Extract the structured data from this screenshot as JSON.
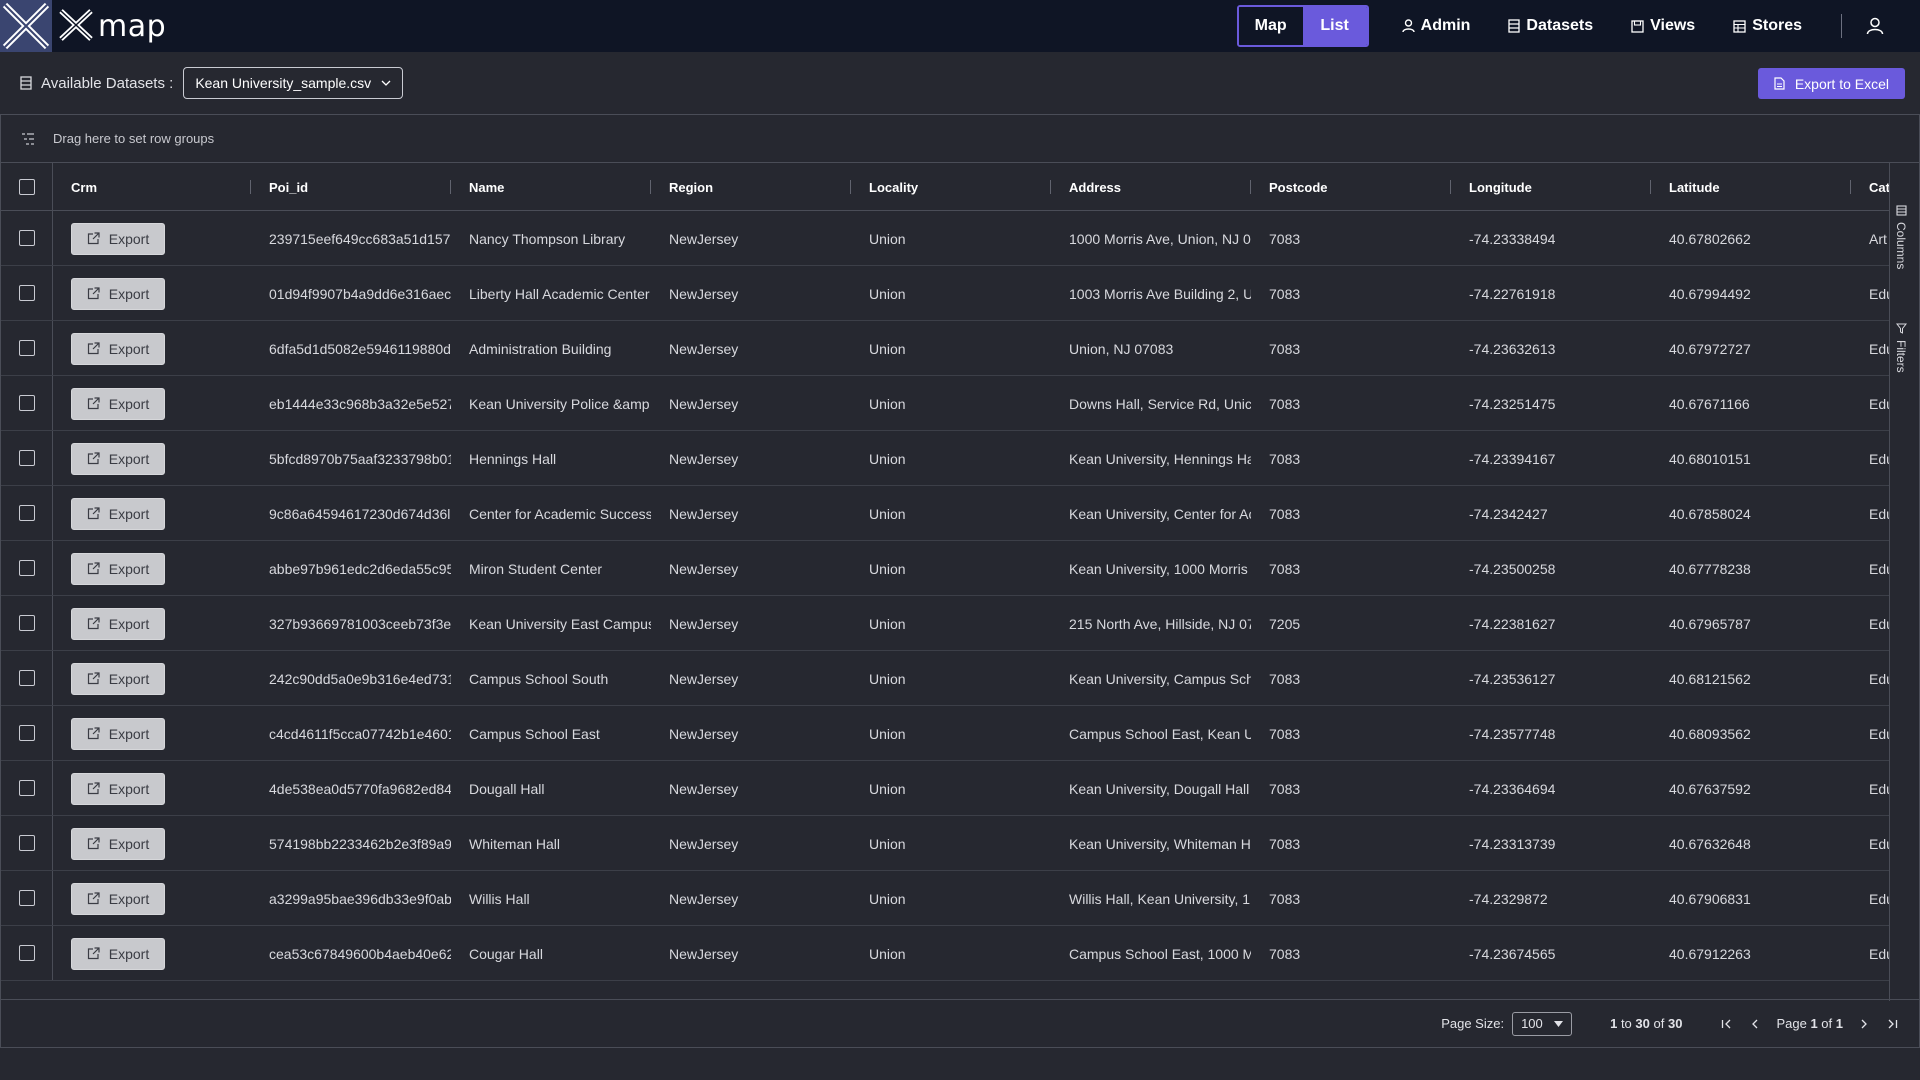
{
  "app": {
    "logo_text": "map"
  },
  "nav": {
    "map": "Map",
    "list": "List",
    "admin": "Admin",
    "datasets": "Datasets",
    "views": "Views",
    "stores": "Stores"
  },
  "toolbar": {
    "available_label": "Available Datasets :",
    "dataset_selected": "Kean University_sample.csv",
    "export_excel": "Export to Excel"
  },
  "grid": {
    "group_hint": "Drag here to set row groups",
    "export_label": "Export",
    "columns": [
      "Crm",
      "Poi_id",
      "Name",
      "Region",
      "Locality",
      "Address",
      "Postcode",
      "Longitude",
      "Latitude",
      "Cat"
    ],
    "side_columns": "Columns",
    "side_filters": "Filters",
    "rows": [
      {
        "poi_id": "239715eef649cc683a51d157",
        "name": "Nancy Thompson Library",
        "region": "NewJersey",
        "locality": "Union",
        "address": "1000 Morris Ave, Union, NJ 0",
        "postcode": "7083",
        "lon": "-74.23338494",
        "lat": "40.67802662",
        "cat": "Art"
      },
      {
        "poi_id": "01d94f9907b4a9dd6e316aec",
        "name": "Liberty Hall Academic Center",
        "region": "NewJersey",
        "locality": "Union",
        "address": "1003 Morris Ave Building 2, U",
        "postcode": "7083",
        "lon": "-74.22761918",
        "lat": "40.67994492",
        "cat": "Edu"
      },
      {
        "poi_id": "6dfa5d1d5082e5946119880d",
        "name": "Administration Building",
        "region": "NewJersey",
        "locality": "Union",
        "address": "Union, NJ 07083",
        "postcode": "7083",
        "lon": "-74.23632613",
        "lat": "40.67972727",
        "cat": "Edu"
      },
      {
        "poi_id": "eb1444e33c968b3a32e5e527",
        "name": "Kean University Police &amp",
        "region": "NewJersey",
        "locality": "Union",
        "address": "Downs Hall, Service Rd, Unic",
        "postcode": "7083",
        "lon": "-74.23251475",
        "lat": "40.67671166",
        "cat": "Edu"
      },
      {
        "poi_id": "5bfcd8970b75aaf3233798b01",
        "name": "Hennings Hall",
        "region": "NewJersey",
        "locality": "Union",
        "address": "Kean University, Hennings Ha",
        "postcode": "7083",
        "lon": "-74.23394167",
        "lat": "40.68010151",
        "cat": "Edu"
      },
      {
        "poi_id": "9c86a64594617230d674d36l",
        "name": "Center for Academic Success",
        "region": "NewJersey",
        "locality": "Union",
        "address": "Kean University, Center for Ac",
        "postcode": "7083",
        "lon": "-74.2342427",
        "lat": "40.67858024",
        "cat": "Edu"
      },
      {
        "poi_id": "abbe97b961edc2d6eda55c95",
        "name": "Miron Student Center",
        "region": "NewJersey",
        "locality": "Union",
        "address": "Kean University, 1000 Morris",
        "postcode": "7083",
        "lon": "-74.23500258",
        "lat": "40.67778238",
        "cat": "Edu"
      },
      {
        "poi_id": "327b93669781003ceeb73f3e",
        "name": "Kean University East Campus",
        "region": "NewJersey",
        "locality": "Union",
        "address": "215 North Ave, Hillside, NJ 07",
        "postcode": "7205",
        "lon": "-74.22381627",
        "lat": "40.67965787",
        "cat": "Edu"
      },
      {
        "poi_id": "242c90dd5a0e9b316e4ed731",
        "name": "Campus School South",
        "region": "NewJersey",
        "locality": "Union",
        "address": "Kean University, Campus Sch",
        "postcode": "7083",
        "lon": "-74.23536127",
        "lat": "40.68121562",
        "cat": "Edu"
      },
      {
        "poi_id": "c4cd4611f5cca07742b1e4601",
        "name": "Campus School East",
        "region": "NewJersey",
        "locality": "Union",
        "address": "Campus School East, Kean U",
        "postcode": "7083",
        "lon": "-74.23577748",
        "lat": "40.68093562",
        "cat": "Edu"
      },
      {
        "poi_id": "4de538ea0d5770fa9682ed84",
        "name": "Dougall Hall",
        "region": "NewJersey",
        "locality": "Union",
        "address": "Kean University, Dougall Hall",
        "postcode": "7083",
        "lon": "-74.23364694",
        "lat": "40.67637592",
        "cat": "Edu"
      },
      {
        "poi_id": "574198bb2233462b2e3f89a9",
        "name": "Whiteman Hall",
        "region": "NewJersey",
        "locality": "Union",
        "address": "Kean University, Whiteman H",
        "postcode": "7083",
        "lon": "-74.23313739",
        "lat": "40.67632648",
        "cat": "Edu"
      },
      {
        "poi_id": "a3299a95bae396db33e9f0ab",
        "name": "Willis Hall",
        "region": "NewJersey",
        "locality": "Union",
        "address": "Willis Hall, Kean University, 1",
        "postcode": "7083",
        "lon": "-74.2329872",
        "lat": "40.67906831",
        "cat": "Edu"
      },
      {
        "poi_id": "cea53c67849600b4aeb40e62",
        "name": "Cougar Hall",
        "region": "NewJersey",
        "locality": "Union",
        "address": "Campus School East, 1000 M",
        "postcode": "7083",
        "lon": "-74.23674565",
        "lat": "40.67912263",
        "cat": "Edu"
      }
    ]
  },
  "footer": {
    "page_size_label": "Page Size:",
    "page_size_value": "100",
    "range_from": "1",
    "range_to_word": "to",
    "range_to": "30",
    "range_of_word": "of",
    "range_total": "30",
    "page_word": "Page",
    "page_current": "1",
    "page_of_word": "of",
    "page_total": "1"
  },
  "colors": {
    "accent": "#6a5adc",
    "nav_bg": "#0f1525",
    "page_bg": "#262830"
  }
}
